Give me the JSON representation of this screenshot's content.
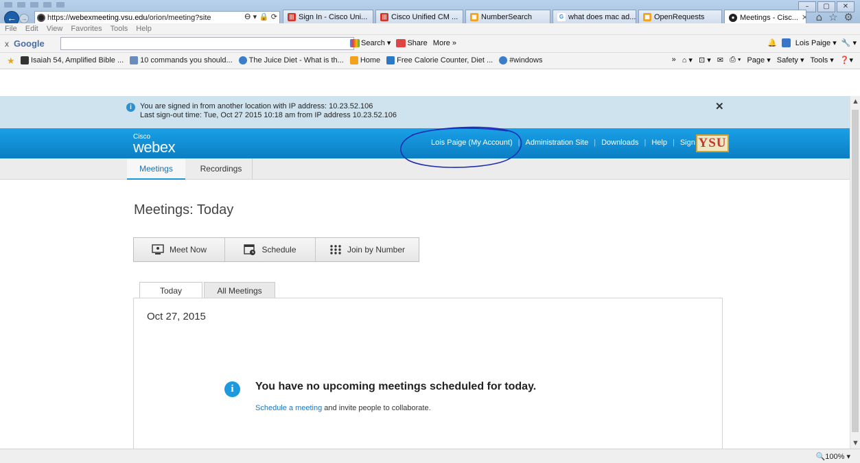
{
  "browser": {
    "window_controls": [
      "–",
      "▢",
      "✕"
    ],
    "url_prefix": "https://",
    "url_host": "webexmeeting.vsu.edu",
    "url_path": "/orion/meeting?site",
    "url_tools": "Ꮎ ▾ 🔒 ⟳",
    "tabs": [
      {
        "label": "Sign In - Cisco Uni...",
        "color": "#d1362b",
        "glyph": "cisco"
      },
      {
        "label": "Cisco Unified CM ...",
        "color": "#d1362b",
        "glyph": "cisco"
      },
      {
        "label": "NumberSearch",
        "color": "#f3a21b",
        "glyph": "NS"
      },
      {
        "label": "what does mac ad...",
        "color": "#ffffff",
        "glyph": "G"
      },
      {
        "label": "OpenRequests",
        "color": "#f3a21b",
        "glyph": "OR"
      },
      {
        "label": "Meetings - Cisc...",
        "color": "#222222",
        "glyph": "●",
        "active": true
      }
    ],
    "right_icons": [
      "⌂",
      "☆",
      "⚙"
    ],
    "menu": [
      "File",
      "Edit",
      "View",
      "Favorites",
      "Tools",
      "Help"
    ],
    "google": {
      "close": "x",
      "label": "Google",
      "search": "Search ▾",
      "share": "Share",
      "more": "More »",
      "user": "Lois Paige ▾",
      "wrench": "🔧 ▾"
    },
    "favorites": [
      {
        "label": "Isaiah 54, Amplified Bible ...",
        "color": "#333333"
      },
      {
        "label": "10 commands you should...",
        "color": "#6a8bbd"
      },
      {
        "label": "The Juice Diet - What is th...",
        "color": "#3c7dc9"
      },
      {
        "label": "Home",
        "color": "#f3a21b"
      },
      {
        "label": "Free Calorie Counter, Diet ...",
        "color": "#2b78c5"
      },
      {
        "label": "#windows",
        "color": "#3c7dc9"
      }
    ],
    "fav_right": [
      "»",
      "⌂ ▾",
      "⊡ ▾",
      "✉",
      "⎙ ▾",
      "Page ▾",
      "Safety ▾",
      "Tools ▾",
      "❓▾"
    ],
    "zoom": "🔍100% ▾"
  },
  "notice": {
    "line1": "You are signed in from another location with IP address: 10.23.52.106",
    "line2": "Last sign-out time: Tue, Oct 27 2015 10:18 am from IP address 10.23.52.106",
    "close": "✕"
  },
  "header": {
    "brand_small": "Cisco",
    "brand": "webex",
    "links": [
      "Lois Paige (My Account)",
      "Administration Site",
      "Downloads",
      "Help",
      "Sign Out"
    ],
    "logo": "YSU",
    "accent": "#0b8fd6"
  },
  "subnav": {
    "tabs": [
      "Meetings",
      "Recordings"
    ]
  },
  "page": {
    "title": "Meetings: Today",
    "buttons": [
      "Meet Now",
      "Schedule",
      "Join by Number"
    ],
    "tabs": [
      "Today",
      "All Meetings"
    ],
    "date": "Oct 27, 2015",
    "empty_msg": "You have no upcoming meetings scheduled for today.",
    "sub_link": "Schedule a meeting",
    "sub_rest": " and invite people to collaborate."
  }
}
